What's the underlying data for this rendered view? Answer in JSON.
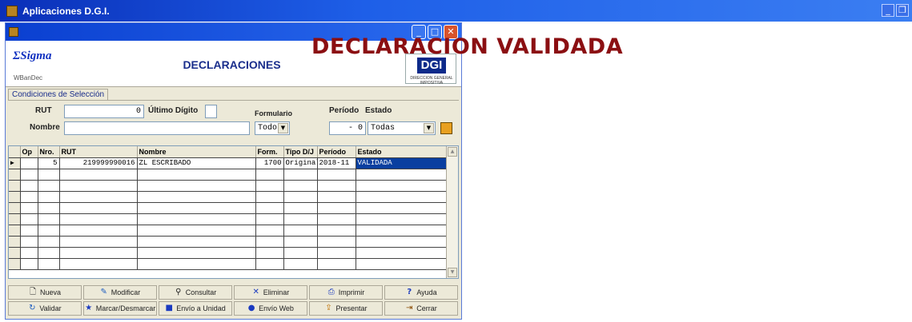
{
  "app": {
    "title": "Aplicaciones D.G.I."
  },
  "window": {
    "logo": "Sigma",
    "sub_logo": "WBanDec",
    "title": "DECLARACIONES",
    "dgi_logo": "DGI",
    "dgi_caption": "DIRECCION GENERAL IMPOSITIVA"
  },
  "selection": {
    "tab_label": "Condiciones de Selección",
    "rut_label": "RUT",
    "rut_value": "0",
    "ultimo_digito_label": "Último Dígito",
    "ultimo_digito_value": "",
    "nombre_label": "Nombre",
    "nombre_value": "",
    "formulario_label": "Formulario",
    "formulario_value": "Todos",
    "periodo_label": "Período",
    "periodo_value": "- 0",
    "estado_label": "Estado",
    "estado_value": "Todas"
  },
  "table": {
    "headers": [
      "Op",
      "Nro.",
      "RUT",
      "Nombre",
      "Form.",
      "Tipo D/J",
      "Período",
      "Estado"
    ],
    "rows": [
      {
        "op": "",
        "nro": "5",
        "rut": "219999990016",
        "nombre": "ZL ESCRIBADO",
        "form": "1700",
        "tipo": "Original",
        "periodo": "2018-11",
        "estado": "VALIDADA"
      }
    ]
  },
  "toolbar": {
    "nueva": "Nueva",
    "modificar": "Modificar",
    "consultar": "Consultar",
    "eliminar": "Eliminar",
    "imprimir": "Imprimir",
    "ayuda": "Ayuda",
    "validar": "Validar",
    "marcar": "Marcar/Desmarcar",
    "envio_unidad": "Envío a Unidad",
    "envio_web": "Envío Web",
    "presentar": "Presentar",
    "cerrar": "Cerrar"
  },
  "banner": "DECLARACION VALIDADA",
  "colors": {
    "banner": "#8b0f12",
    "title_blue": "#1a2e8c",
    "selection": "#0a3fa0"
  }
}
